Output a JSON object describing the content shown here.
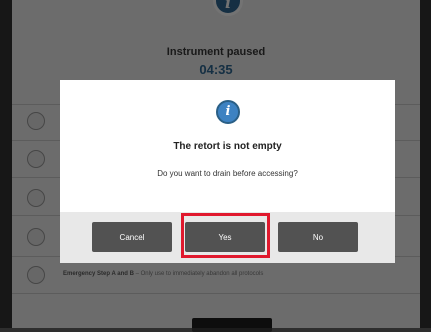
{
  "background": {
    "status_title": "Instrument paused",
    "timer": "04:35",
    "emergency_row": {
      "title": "Emergency Step A and B",
      "description": "– Only use to immediately abandon all protocols"
    }
  },
  "dialog": {
    "icon": "info-icon",
    "title": "The retort is not empty",
    "message": "Do you want to drain before accessing?",
    "buttons": {
      "cancel": "Cancel",
      "yes": "Yes",
      "no": "No"
    },
    "highlight_color": "#e0182d",
    "button_color": "#525252",
    "accent_color": "#3d82c2"
  }
}
